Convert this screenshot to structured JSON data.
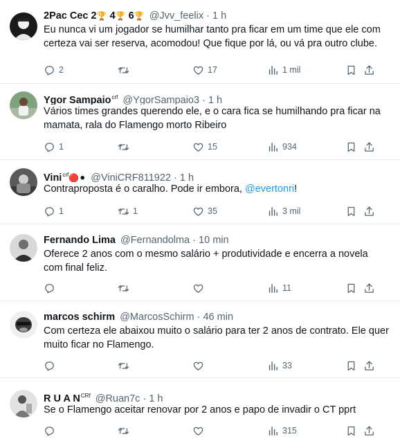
{
  "tweets": [
    {
      "name": "2Pac Cec 2",
      "badges": [
        "🏆",
        "4",
        "🏆",
        "6",
        "🏆"
      ],
      "handle": "@Jvv_feelix",
      "time": "1 h",
      "text": "Eu nunca vi um jogador se humilhar tanto pra ficar em um time que ele com certeza vai ser reserva, acomodou! Que fique por lá, ou vá pra outro clube.",
      "replies": "2",
      "retweets": "",
      "likes": "17",
      "views": "1 mil"
    },
    {
      "name": "Ygor Sampaio",
      "name_sup": "crf",
      "handle": "@YgorSampaio3",
      "time": "1 h",
      "text": "Vários times grandes querendo ele, e o cara fica se humilhando pra ficar na mamata, rala do Flamengo morto Ribeiro",
      "replies": "1",
      "retweets": "",
      "likes": "15",
      "views": "934"
    },
    {
      "name": "Vini",
      "name_sup": "crf",
      "name_emoji": "🔴⚫",
      "handle": "@ViniCRF811922",
      "time": "1 h",
      "text_before": "Contraproposta é o caralho. Pode ir embora, ",
      "mention": "@evertonri",
      "text_after": "!",
      "replies": "1",
      "retweets": "1",
      "likes": "35",
      "views": "3 mil"
    },
    {
      "name": "Fernando Lima",
      "handle": "@Fernandolma",
      "time": "10 min",
      "text": "Oferece 2 anos com o mesmo salário + produtividade e encerra a novela com final feliz.",
      "replies": "",
      "retweets": "",
      "likes": "",
      "views": "11"
    },
    {
      "name": "marcos schirm",
      "handle": "@MarcosSchirm",
      "time": "46 min",
      "text": "Com certeza ele abaixou muito o salário para ter 2 anos de contrato. Ele quer muito ficar no Flamengo.",
      "replies": "",
      "retweets": "",
      "likes": "",
      "views": "33"
    },
    {
      "name": "R U A N",
      "name_sup": "CRf",
      "handle": "@Ruan7c",
      "time": "1 h",
      "text": "Se o Flamengo aceitar renovar por 2 anos e papo de invadir o CT pprt",
      "replies": "",
      "retweets": "",
      "likes": "",
      "views": "315"
    }
  ],
  "ui": {
    "separator": "·",
    "more_label": "···"
  },
  "icons": {
    "reply": "reply-icon",
    "retweet": "retweet-icon",
    "like": "heart-icon",
    "views": "views-icon",
    "bookmark": "bookmark-icon",
    "share": "share-icon",
    "more": "more-icon"
  },
  "colors": {
    "text": "#0f1419",
    "muted": "#536471",
    "link": "#1d9bf0",
    "divider": "#e6ecf0"
  }
}
